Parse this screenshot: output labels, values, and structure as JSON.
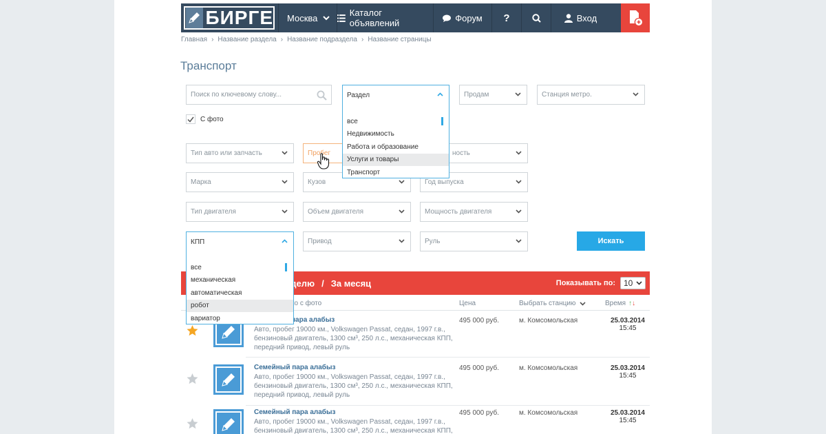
{
  "header": {
    "logo_text": "БИРГЕ",
    "city": "Москва",
    "catalog": "Каталог объявлений",
    "forum": "Форум",
    "help": "?",
    "login": "Вход"
  },
  "breadcrumb": [
    "Главная",
    "Название раздела",
    "Название подраздела",
    "Название страницы"
  ],
  "title": "Транспорт",
  "filters": {
    "search_placeholder": "Поиск по ключевому слову...",
    "section_label": "Раздел",
    "section_options": [
      "все",
      "Недвижимость",
      "Работа и образование",
      "Услуги и товары",
      "Транспорт"
    ],
    "sell": "Продам",
    "metro": "Станция метро.",
    "photo_label": "С фото",
    "car_type": "Тип авто или запчасть",
    "mileage": "Пробег",
    "condition_partial": "ность",
    "brand": "Марка",
    "body": "Кузов",
    "year": "Год выпуска",
    "engine_type": "Тип двигателя",
    "engine_volume": "Объем двигателя",
    "engine_power": "Мощность двигателя",
    "gearbox_label": "КПП",
    "gearbox_options": [
      "все",
      "механическая",
      "автоматическая",
      "робот",
      "вариатор"
    ],
    "drive": "Привод",
    "steering": "Руль",
    "search_button": "Искать"
  },
  "listing_bar": {
    "period_week": "еделю",
    "period_sep": "/",
    "period_month": "За месяц",
    "show_by": "Показывать по:",
    "per_page": "10"
  },
  "columns": {
    "photo": "ко с фото",
    "price": "Цена",
    "station": "Выбрать станцию",
    "time": "Время"
  },
  "listings": [
    {
      "title": "пара алабыз",
      "desc": "Авто, пробег 19000 км., Volkswagen Passat, седан, 1997 г.в., бензиновый двигатель, 1300 см³, 250 л.с., механическая КПП, передний привод, левый руль",
      "price": "495 000 руб.",
      "metro": "м. Комсомольская",
      "date": "25.03.2014",
      "time": "15:45",
      "starred": true
    },
    {
      "title": "Семейный пара алабыз",
      "desc": "Авто, пробег 19000 км., Volkswagen Passat, седан, 1997 г.в., бензиновый двигатель, 1300 см³, 250 л.с., механическая КПП, передний привод, левый руль",
      "price": "495 000 руб.",
      "metro": "м. Комсомольская",
      "date": "25.03.2014",
      "time": "15:45",
      "starred": false
    },
    {
      "title": "Семейный пара алабыз",
      "desc": "Авто, пробег 19000 км., Volkswagen Passat, седан, 1997 г.в., бензиновый двигатель, 1300 см³, 250 л.с., механическая КПП,",
      "price": "495 000 руб.",
      "metro": "м. Комсомольская",
      "date": "25.03.2014",
      "time": "15:45",
      "starred": false
    }
  ],
  "colors": {
    "header_bg": "#354a5f",
    "accent_red": "#e8453c",
    "accent_blue": "#27a8e6",
    "link_blue": "#3b6f98",
    "star_active": "#f5a623",
    "star_inactive": "#c8cdd1"
  }
}
